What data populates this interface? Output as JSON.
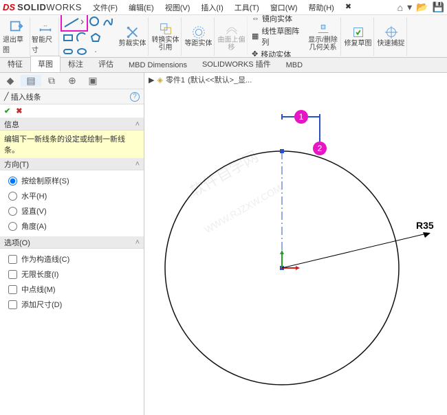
{
  "app": {
    "logo_ds": "DS",
    "logo_solid": "SOLID",
    "logo_works": "WORKS"
  },
  "menu": [
    "文件(F)",
    "编辑(E)",
    "视图(V)",
    "插入(I)",
    "工具(T)",
    "窗口(W)",
    "帮助(H)",
    "✖"
  ],
  "ribbon": {
    "exit": "退出草图",
    "smart_dim": "智能尺寸",
    "trim": "剪裁实体",
    "convert": "转换实体引用",
    "offset": "等距实体",
    "surf": "曲面上偏移",
    "mirror": "镜向实体",
    "linear": "线性草图阵列",
    "move": "移动实体",
    "showdel": "显示/删除几何关系",
    "repair": "修复草图",
    "quick": "快速捕捉"
  },
  "tabs": [
    "特征",
    "草图",
    "标注",
    "评估",
    "MBD Dimensions",
    "SOLIDWORKS 插件",
    "MBD"
  ],
  "crumb": {
    "part": "零件1",
    "rest": "(默认<<默认>_显..."
  },
  "pm": {
    "title": "插入线条",
    "info_h": "信息",
    "info_body": "编辑下一新线条的设定或绘制一新线条。",
    "orient_h": "方向(T)",
    "o1": "按绘制原样(S)",
    "o2": "水平(H)",
    "o3": "竖直(V)",
    "o4": "角度(A)",
    "opt_h": "选项(O)",
    "c1": "作为构造线(C)",
    "c2": "无限长度(I)",
    "c3": "中点线(M)",
    "c4": "添加尺寸(D)"
  },
  "chart_data": {
    "type": "diagram",
    "circle_radius": 35,
    "dim_label": "R35",
    "balloons": [
      "1",
      "2"
    ]
  }
}
